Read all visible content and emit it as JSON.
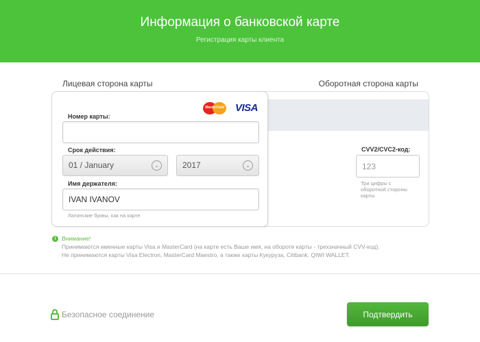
{
  "header": {
    "title": "Информация о банковской карте",
    "subtitle": "Регистрация карты клиента",
    "color": "#4cc33b"
  },
  "front": {
    "side_label": "Лицевая сторона карты",
    "logos": {
      "mastercard": "MasterCard",
      "visa": "VISA"
    },
    "card_number": {
      "label": "Номер карты:",
      "value": ""
    },
    "expiry": {
      "label": "Срок действия:",
      "month": "01 / January",
      "year": "2017"
    },
    "holder": {
      "label": "Имя держателя:",
      "value": "IVAN IVANOV",
      "hint": "Латинские буквы, как на карте"
    }
  },
  "back": {
    "side_label": "Оборотная сторона карты",
    "cvv": {
      "label": "CVV2/CVC2-код:",
      "placeholder": "123",
      "hint": "Три цифры с оборотной стороны карты"
    }
  },
  "notice": {
    "heading": "Внимание!",
    "line1": "Принимаются именные карты Visa и MasterCard (на карте есть Ваше имя, на обороте карты - трехзначный CVV-код).",
    "line2": "Не принимаются карты Visa Electron, MasterCard Maestro, а также карты Кукуруза, Citibank, QIWI WALLET."
  },
  "footer": {
    "secure_label": "Безопасное соединение",
    "confirm_label": "Подтвердить"
  }
}
